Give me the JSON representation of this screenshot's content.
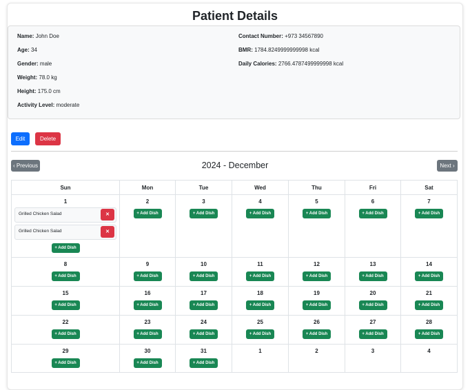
{
  "header": {
    "title": "Patient Details"
  },
  "patient": {
    "name_label": "Name:",
    "name": "John Doe",
    "age_label": "Age:",
    "age": "34",
    "gender_label": "Gender:",
    "gender": "male",
    "weight_label": "Weight:",
    "weight": "78.0 kg",
    "height_label": "Height:",
    "height": "175.0 cm",
    "activity_label": "Activity Level:",
    "activity": "moderate",
    "contact_label": "Contact Number:",
    "contact": "+973 34567890",
    "bmr_label": "BMR:",
    "bmr": "1784.8249999999998 kcal",
    "calories_label": "Daily Calories:",
    "calories": "2766.4787499999998 kcal"
  },
  "actions": {
    "edit": "Edit",
    "delete": "Delete"
  },
  "calendar": {
    "prev": "‹ Previous",
    "next": "Next ›",
    "month_title": "2024 - December",
    "days": [
      "Sun",
      "Mon",
      "Tue",
      "Wed",
      "Thu",
      "Fri",
      "Sat"
    ],
    "add_label": "+ Add Dish",
    "weeks": [
      [
        {
          "day": "1",
          "add": true,
          "dishes": [
            "Grilled Chicken Salad",
            "Grilled Chicken Salad"
          ]
        },
        {
          "day": "2",
          "add": true,
          "dishes": []
        },
        {
          "day": "3",
          "add": true,
          "dishes": []
        },
        {
          "day": "4",
          "add": true,
          "dishes": []
        },
        {
          "day": "5",
          "add": true,
          "dishes": []
        },
        {
          "day": "6",
          "add": true,
          "dishes": []
        },
        {
          "day": "7",
          "add": true,
          "dishes": []
        }
      ],
      [
        {
          "day": "8",
          "add": true,
          "dishes": []
        },
        {
          "day": "9",
          "add": true,
          "dishes": []
        },
        {
          "day": "10",
          "add": true,
          "dishes": []
        },
        {
          "day": "11",
          "add": true,
          "dishes": []
        },
        {
          "day": "12",
          "add": true,
          "dishes": []
        },
        {
          "day": "13",
          "add": true,
          "dishes": []
        },
        {
          "day": "14",
          "add": true,
          "dishes": []
        }
      ],
      [
        {
          "day": "15",
          "add": true,
          "dishes": []
        },
        {
          "day": "16",
          "add": true,
          "dishes": []
        },
        {
          "day": "17",
          "add": true,
          "dishes": []
        },
        {
          "day": "18",
          "add": true,
          "dishes": []
        },
        {
          "day": "19",
          "add": true,
          "dishes": []
        },
        {
          "day": "20",
          "add": true,
          "dishes": []
        },
        {
          "day": "21",
          "add": true,
          "dishes": []
        }
      ],
      [
        {
          "day": "22",
          "add": true,
          "dishes": []
        },
        {
          "day": "23",
          "add": true,
          "dishes": []
        },
        {
          "day": "24",
          "add": true,
          "dishes": []
        },
        {
          "day": "25",
          "add": true,
          "dishes": []
        },
        {
          "day": "26",
          "add": true,
          "dishes": []
        },
        {
          "day": "27",
          "add": true,
          "dishes": []
        },
        {
          "day": "28",
          "add": true,
          "dishes": []
        }
      ],
      [
        {
          "day": "29",
          "add": true,
          "dishes": []
        },
        {
          "day": "30",
          "add": true,
          "dishes": []
        },
        {
          "day": "31",
          "add": true,
          "dishes": []
        },
        {
          "day": "1",
          "add": false,
          "dishes": []
        },
        {
          "day": "2",
          "add": false,
          "dishes": []
        },
        {
          "day": "3",
          "add": false,
          "dishes": []
        },
        {
          "day": "4",
          "add": false,
          "dishes": []
        }
      ]
    ]
  },
  "colors": {
    "primary": "#0d6efd",
    "danger": "#dc3545",
    "success": "#198754",
    "secondary": "#6c757d"
  }
}
